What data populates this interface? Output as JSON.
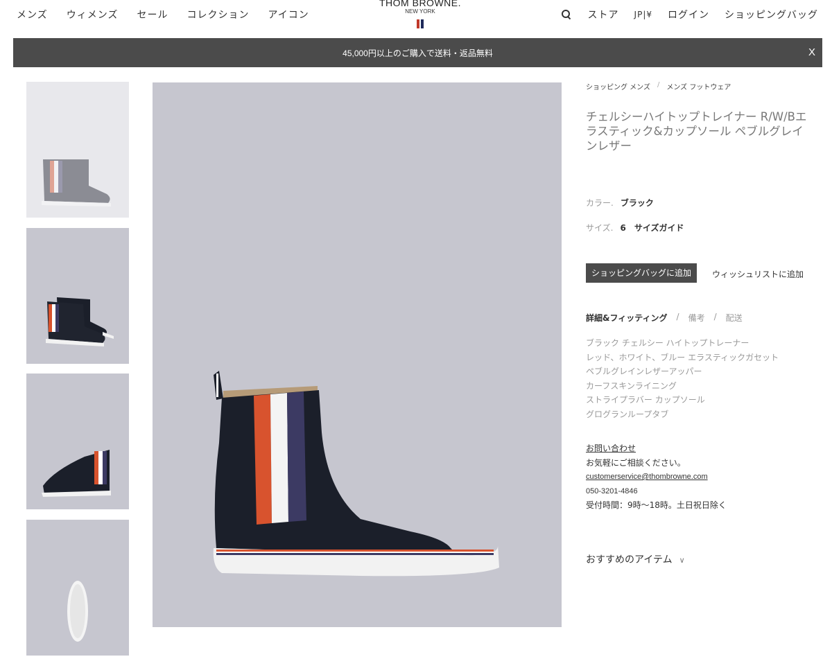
{
  "nav": {
    "left": [
      "メンズ",
      "ウィメンズ",
      "セール",
      "コレクション",
      "アイコン"
    ],
    "right": [
      "ストア",
      "JP|¥",
      "ログイン",
      "ショッピングバッグ"
    ]
  },
  "logo": {
    "main": "THOM BROWNE.",
    "sub": "NEW YORK"
  },
  "banner": {
    "text": "45,000円以上のご購入で送料・返品無料",
    "close": "X"
  },
  "breadcrumb": [
    "ショッピング メンズ",
    "メンズ フットウェア"
  ],
  "breadcrumb_sep": "/",
  "product": {
    "title": "チェルシーハイトップトレイナー R/W/Bエラスティック&カップソール ペブルグレインレザー",
    "color_label": "カラー.",
    "color_value": "ブラック",
    "size_label": "サイズ.",
    "size_value": "6",
    "size_guide": "サイズガイド",
    "add_to_bag": "ショッピングバッグに追加",
    "wishlist": "ウィッシュリストに追加"
  },
  "tabs": [
    "詳細&フィッティング",
    "備考",
    "配送"
  ],
  "tab_sep": "/",
  "description": [
    "ブラック チェルシー ハイトップトレーナー",
    "レッド、ホワイト、ブルー エラスティックガセット",
    "ペブルグレインレザーアッパー",
    "カーフスキンライニング",
    "ストライプラバー カップソール",
    "グログランループタブ"
  ],
  "contact": {
    "heading": "お問い合わせ",
    "line": "お気軽にご相談ください。",
    "email": "customerservice@thombrowne.com",
    "phone": "050-3201-4846",
    "hours": "受付時間：9時〜18時。土日祝日除く"
  },
  "recommend": {
    "label": "おすすめのアイテム",
    "icon": "chevron-down-icon"
  },
  "colors": {
    "banner": "#4b4b4b",
    "image_bg": "#c6c6cf",
    "shoe": "#1b1f2a",
    "red": "#d8532e",
    "navy": "#3c3a63",
    "muted": "#999999"
  }
}
